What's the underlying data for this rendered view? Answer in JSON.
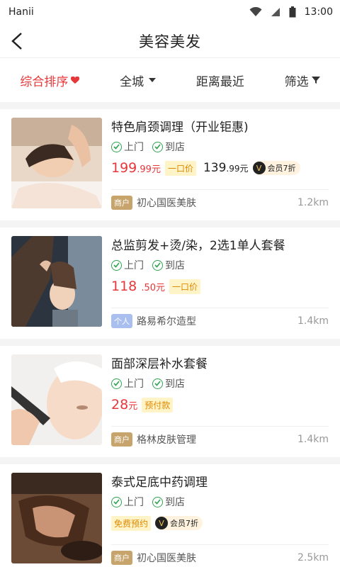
{
  "status": {
    "carrier": "Hanii",
    "time": "13:00"
  },
  "nav": {
    "title": "美容美发"
  },
  "filters": [
    {
      "label": "综合排序"
    },
    {
      "label": "全城"
    },
    {
      "label": "距离最近"
    },
    {
      "label": "筛选"
    }
  ],
  "items": [
    {
      "title": "特色肩颈调理（开业钜惠)",
      "svc1": "上门",
      "svc2": "到店",
      "price_int": "199",
      "price_dec": ".99元",
      "tag": "一口价",
      "vip_int": "139",
      "vip_dec": ".99元",
      "vip_label": "会员7折",
      "shop_type": "商户",
      "shop": "初心国医美肤",
      "distance": "1.2km"
    },
    {
      "title": "总监剪发+烫/染，2选1单人套餐",
      "svc1": "上门",
      "svc2": "到店",
      "price_int": "118",
      "price_dec": ".50元",
      "tag": "一口价",
      "shop_type": "个人",
      "shop": "路易希尔造型",
      "distance": "1.4km"
    },
    {
      "title": "面部深层补水套餐",
      "svc1": "上门",
      "svc2": "到店",
      "price_int": "28",
      "price_dec": "元",
      "tag": "预付款",
      "shop_type": "商户",
      "shop": "格林皮肤管理",
      "distance": "1.4km"
    },
    {
      "title": "泰式足底中药调理",
      "svc1": "上门",
      "svc2": "到店",
      "free_label": "免费预约",
      "vip_label": "会员7折",
      "shop_type": "商户",
      "shop": "初心国医美肤",
      "distance": "2.5km"
    }
  ],
  "vip_icon": "V"
}
